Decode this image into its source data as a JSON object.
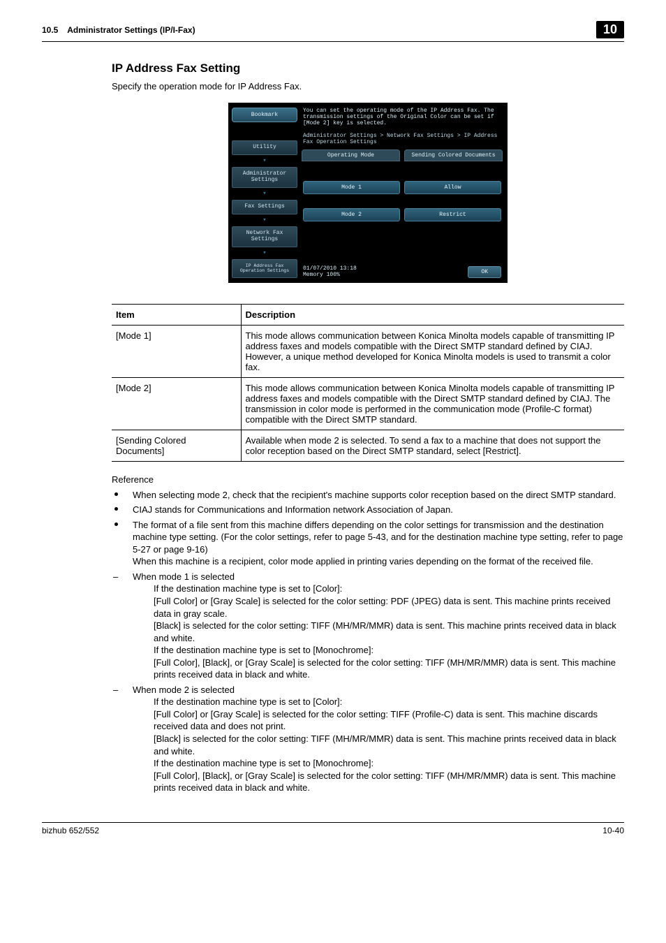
{
  "header": {
    "section_number": "10.5",
    "section_title": "Administrator Settings (IP/I-Fax)",
    "chapter_badge": "10"
  },
  "page": {
    "heading": "IP Address Fax Setting",
    "intro": "Specify the operation mode for IP Address Fax."
  },
  "device": {
    "help_text": "You can set the operating mode of the IP Address Fax. The transmission settings of the Original Color can be set if [Mode 2] key is selected.",
    "breadcrumb_path": "Administrator Settings > Network Fax Settings > IP Address Fax Operation Settings",
    "bookmark_label": "Bookmark",
    "crumbs": [
      "Utility",
      "Administrator Settings",
      "Fax Settings",
      "Network Fax Settings",
      "IP Address Fax Operation Settings"
    ],
    "tabs": [
      "Operating Mode",
      "Sending Colored Documents"
    ],
    "col1": [
      "Mode 1",
      "Mode 2"
    ],
    "col2": [
      "Allow",
      "Restrict"
    ],
    "meta_line1": "01/07/2010   13:18",
    "meta_line2": "Memory       100%",
    "ok_label": "OK"
  },
  "table": {
    "headers": [
      "Item",
      "Description"
    ],
    "rows": [
      {
        "item": "[Mode 1]",
        "desc": "This mode allows communication between Konica Minolta models capable of transmitting IP address faxes and models compatible with the Direct SMTP standard defined by CIAJ. However, a unique method developed for Konica Minolta models is used to transmit a color fax."
      },
      {
        "item": "[Mode 2]",
        "desc": "This mode allows communication between Konica Minolta models capable of transmitting IP address faxes and models compatible with the Direct SMTP standard defined by CIAJ. The transmission in color mode is performed in the communication mode (Profile-C format) compatible with the Direct SMTP standard."
      },
      {
        "item": "[Sending Colored Documents]",
        "desc": "Available when mode 2 is selected. To send a fax to a machine that does not support the color reception based on the Direct SMTP standard, select [Restrict]."
      }
    ]
  },
  "reference": {
    "label": "Reference",
    "b1": "When selecting mode 2, check that the recipient's machine supports color reception based on the direct SMTP standard.",
    "b2": "CIAJ stands for Communications and Information network Association of Japan.",
    "b3a": "The format of a file sent from this machine differs depending on the color settings for transmission and the destination machine type setting. (For the color settings, refer to page 5-43, and for the destination machine type setting, refer to page 5-27 or page 9-16)",
    "b3b": "When this machine is a recipient, color mode applied in printing varies depending on the format of the received file.",
    "m1_title": "When mode 1 is selected",
    "m1_l1": "If the destination machine type is set to [Color]:",
    "m1_l2": "[Full Color] or [Gray Scale] is selected for the color setting: PDF (JPEG) data is sent. This machine prints received data in gray scale.",
    "m1_l3": "[Black] is selected for the color setting: TIFF (MH/MR/MMR) data is sent. This machine prints received data in black and white.",
    "m1_l4": "If the destination machine type is set to [Monochrome]:",
    "m1_l5": "[Full Color], [Black], or [Gray Scale] is selected for the color setting: TIFF (MH/MR/MMR) data is sent. This machine prints received data in black and white.",
    "m2_title": "When mode 2 is selected",
    "m2_l1": "If the destination machine type is set to [Color]:",
    "m2_l2": "[Full Color] or [Gray Scale] is selected for the color setting: TIFF (Profile-C) data is sent. This machine discards received data and does not print.",
    "m2_l3": "[Black] is selected for the color setting: TIFF (MH/MR/MMR) data is sent. This machine prints received data in black and white.",
    "m2_l4": "If the destination machine type is set to [Monochrome]:",
    "m2_l5": "[Full Color], [Black], or [Gray Scale] is selected for the color setting: TIFF (MH/MR/MMR) data is sent. This machine prints received data in black and white."
  },
  "footer": {
    "left": "bizhub 652/552",
    "right": "10-40"
  }
}
